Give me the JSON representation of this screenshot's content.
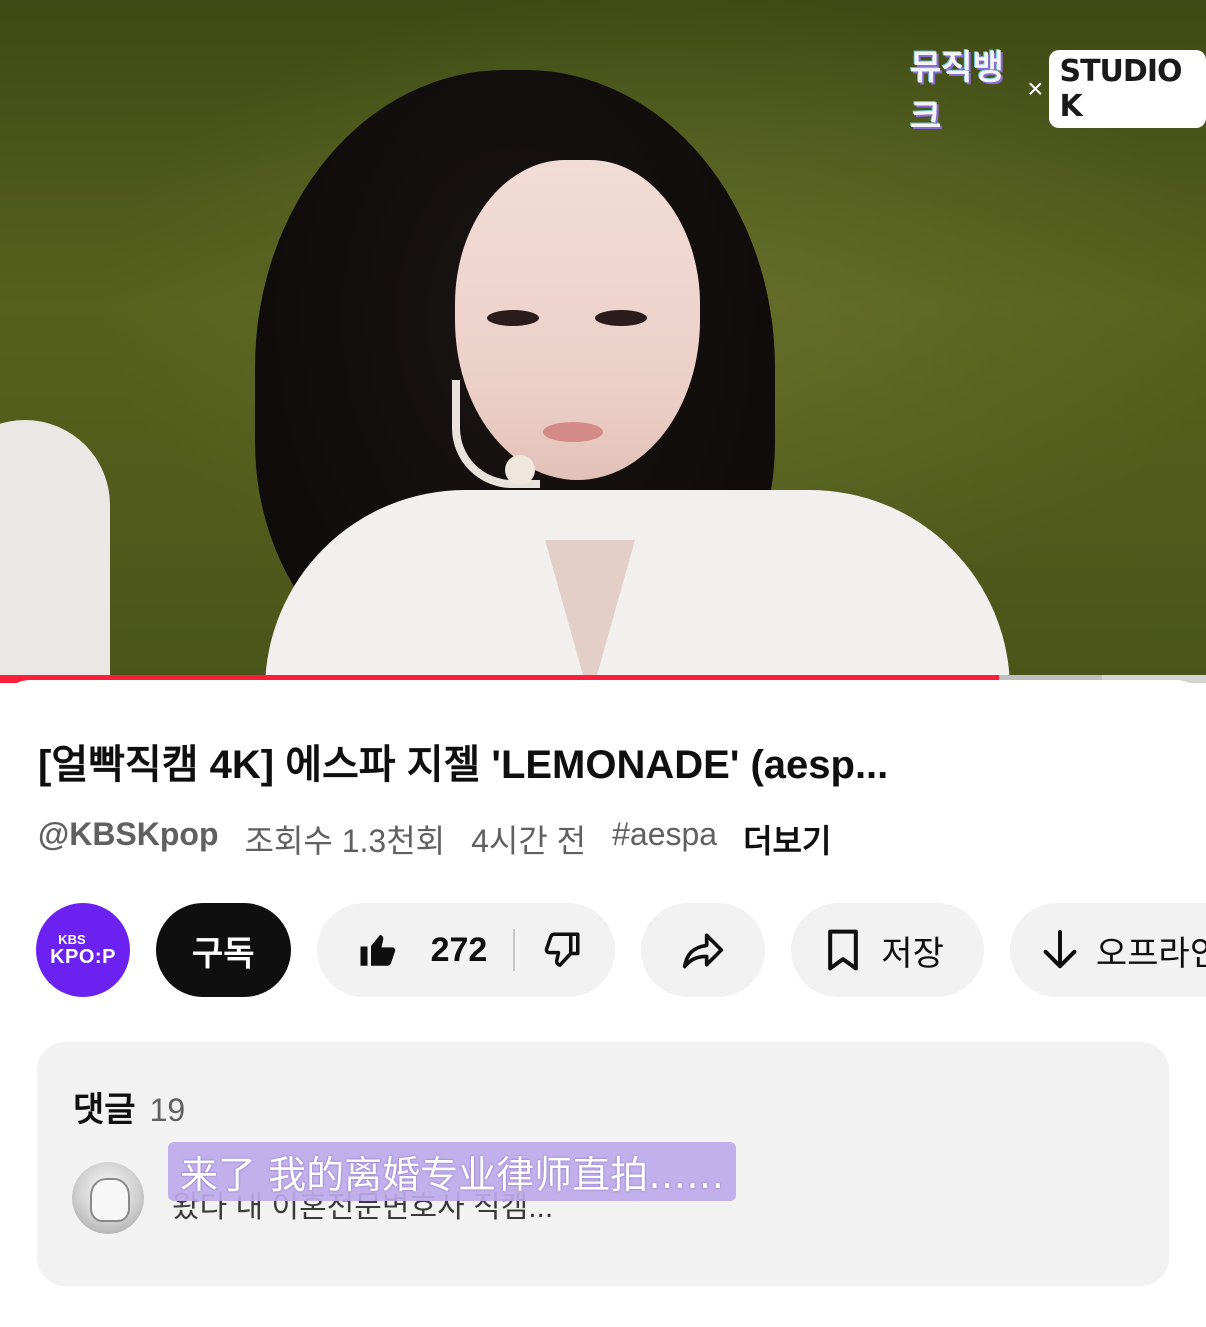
{
  "video": {
    "logo_left": "뮤직뱅크",
    "logo_separator": "×",
    "logo_right": "STUDIO K",
    "progress_fraction": 0.828,
    "buffer_fraction": 0.914,
    "progress_color": "#ff1e39"
  },
  "info": {
    "title": "[얼빡직캠 4K] 에스파 지젤 'LEMONADE' (aesp...",
    "channel_handle": "@KBSKpop",
    "views": "조회수 1.3천회",
    "time_ago": "4시간 전",
    "hashtag": "#aespa",
    "more_label": "더보기"
  },
  "actions": {
    "avatar_small": "KBS",
    "avatar_big": "KPO:P",
    "avatar_color": "#6b21f0",
    "subscribe_label": "구독",
    "like_count": "272",
    "save_label": "저장",
    "offline_label": "오프라인"
  },
  "comments": {
    "label": "댓글",
    "count": "19",
    "first_comment_text": "왔다 내 이혼전문변호사 직캠...",
    "overlay_text": "来了 我的离婚专业律师直拍……"
  }
}
